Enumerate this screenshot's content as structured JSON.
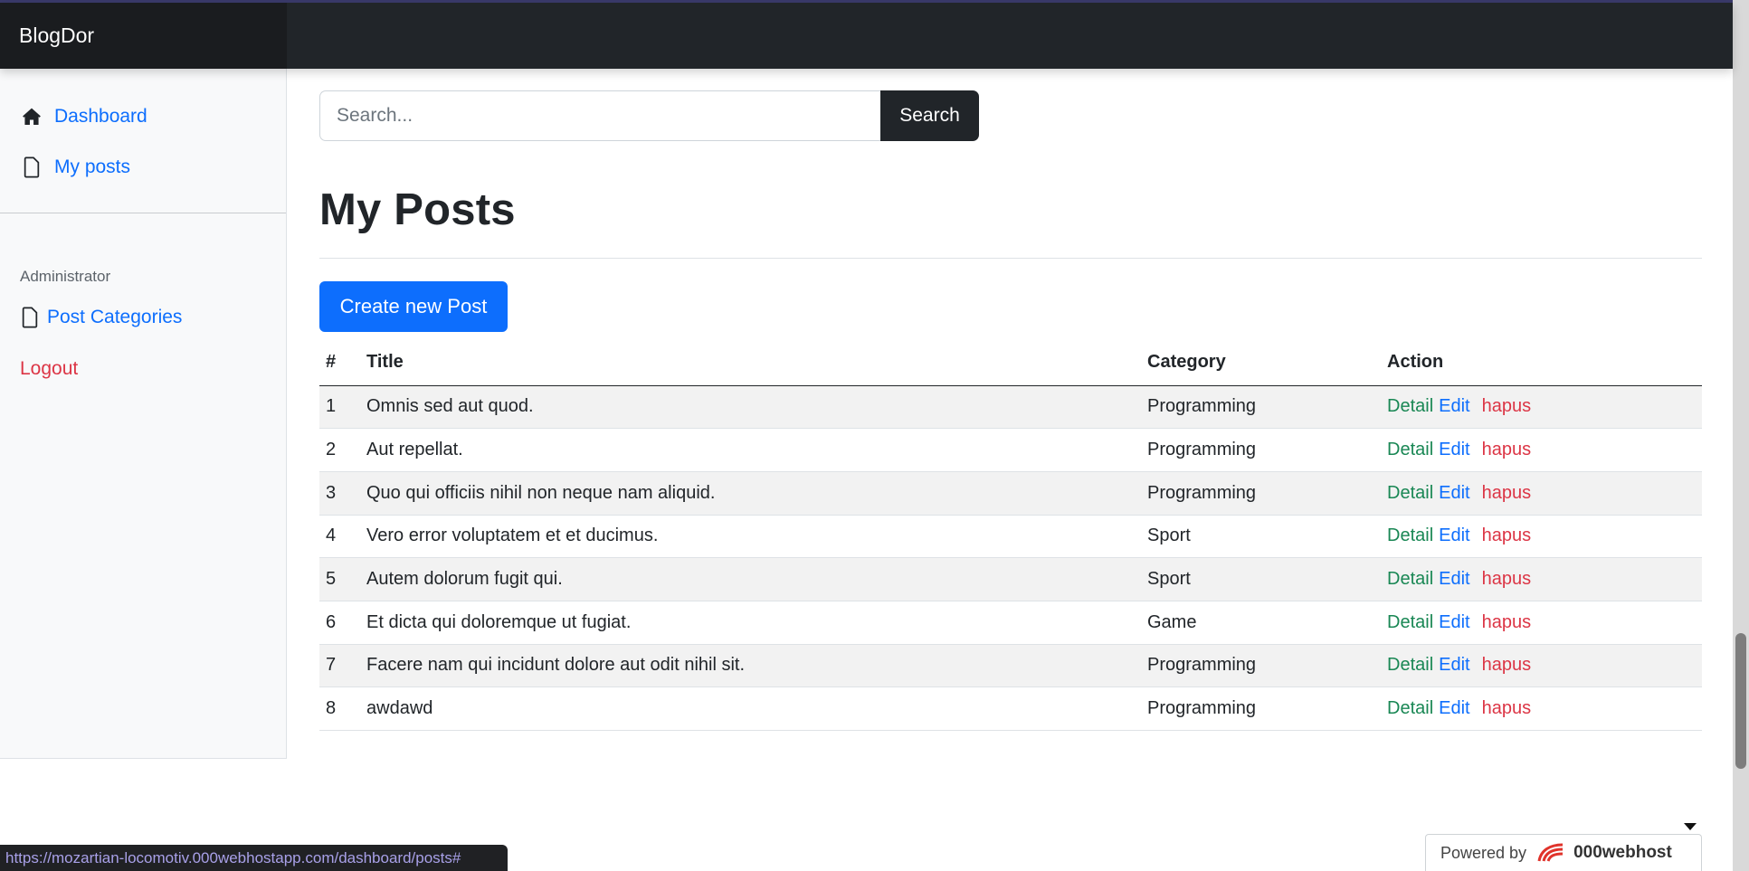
{
  "navbar": {
    "brand": "BlogDor"
  },
  "sidebar": {
    "items": [
      {
        "label": "Dashboard",
        "icon": "house-icon"
      },
      {
        "label": "My posts",
        "icon": "file-icon"
      }
    ],
    "admin_heading": "Administrator",
    "admin_items": [
      {
        "label": "Post Categories",
        "icon": "file-icon"
      }
    ],
    "logout_label": "Logout"
  },
  "search": {
    "placeholder": "Search...",
    "value": "",
    "button_label": "Search"
  },
  "main": {
    "title": "My Posts",
    "create_button_label": "Create new Post"
  },
  "table": {
    "headers": [
      "#",
      "Title",
      "Category",
      "Action"
    ],
    "action_labels": {
      "detail": "Detail",
      "edit": "Edit",
      "delete": "hapus"
    },
    "rows": [
      {
        "num": "1",
        "title": "Omnis sed aut quod.",
        "category": "Programming"
      },
      {
        "num": "2",
        "title": "Aut repellat.",
        "category": "Programming"
      },
      {
        "num": "3",
        "title": "Quo qui officiis nihil non neque nam aliquid.",
        "category": "Programming"
      },
      {
        "num": "4",
        "title": "Vero error voluptatem et et ducimus.",
        "category": "Sport"
      },
      {
        "num": "5",
        "title": "Autem dolorum fugit qui.",
        "category": "Sport"
      },
      {
        "num": "6",
        "title": "Et dicta qui doloremque ut fugiat.",
        "category": "Game"
      },
      {
        "num": "7",
        "title": "Facere nam qui incidunt dolore aut odit nihil sit.",
        "category": "Programming"
      },
      {
        "num": "8",
        "title": "awdawd",
        "category": "Programming"
      }
    ]
  },
  "status_bar": {
    "url": "https://mozartian-locomotiv.000webhostapp.com/dashboard/posts#"
  },
  "hosting_badge": {
    "prefix": "Powered by",
    "brand": "000webhost"
  },
  "colors": {
    "navbar": "#212529",
    "primary": "#0d6efd",
    "success": "#198754",
    "danger": "#dc3545",
    "sidebar_bg": "#f8f9fa"
  }
}
